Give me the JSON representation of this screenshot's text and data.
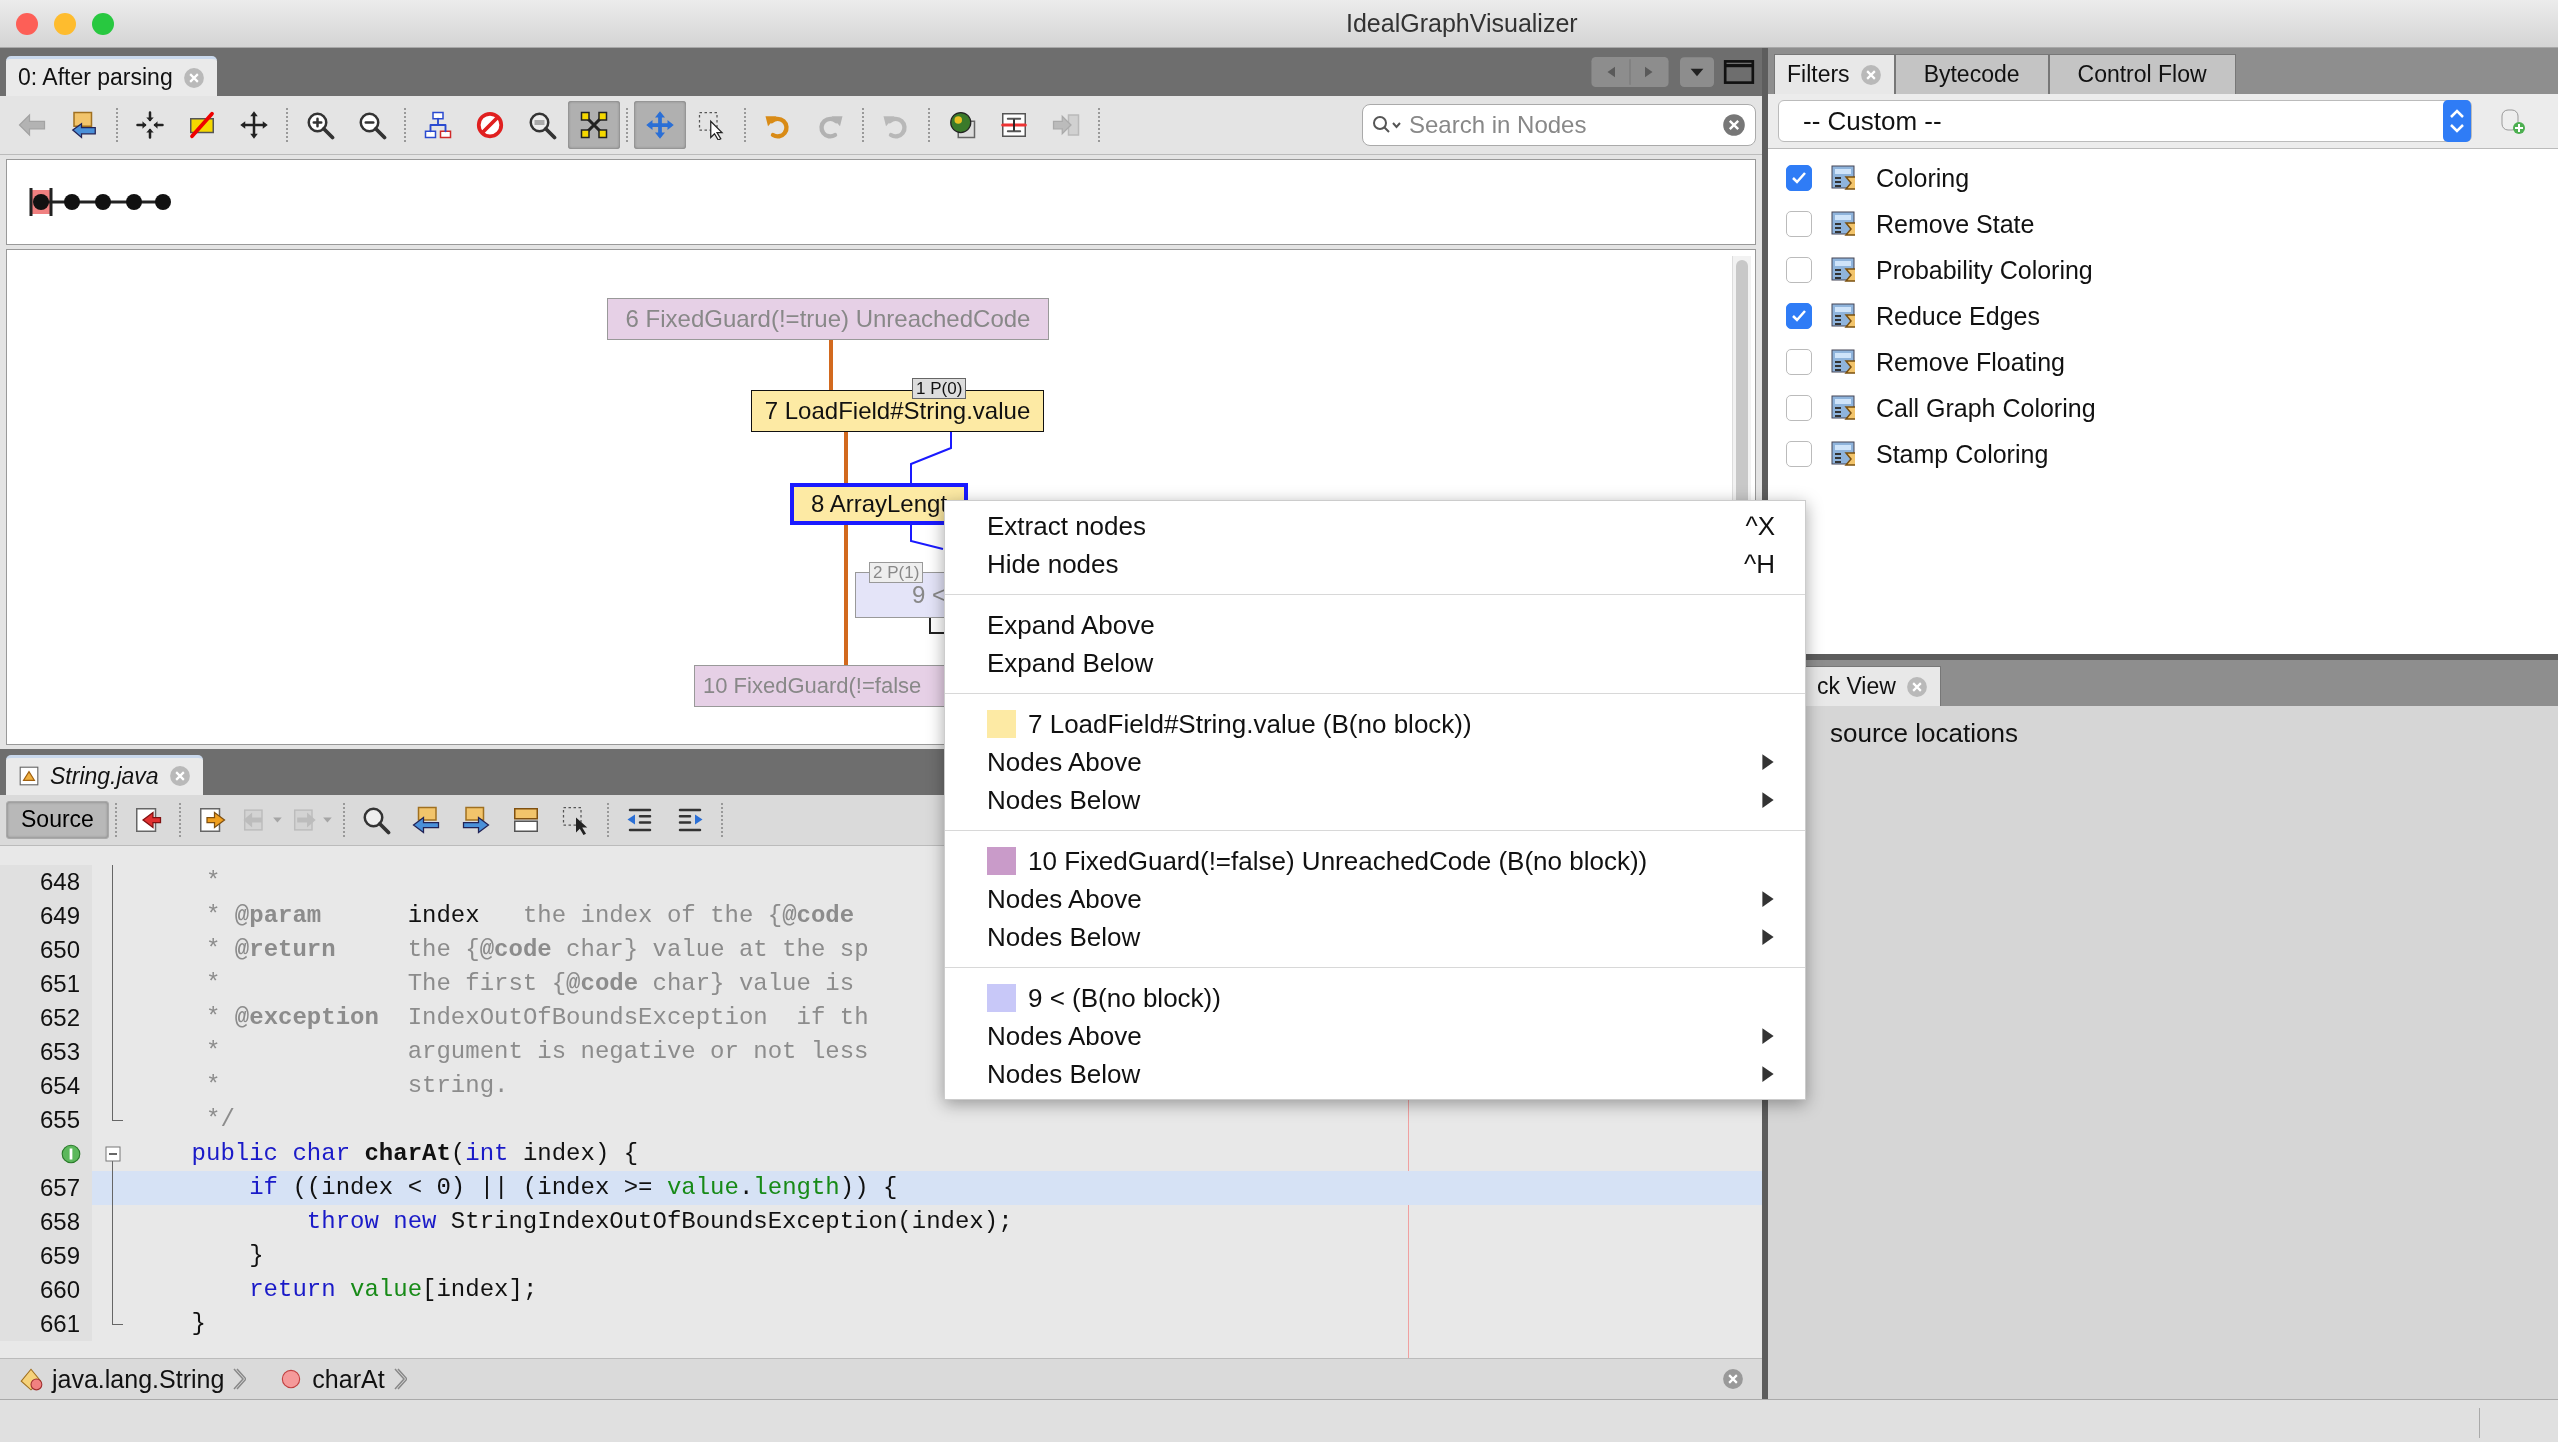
{
  "window": {
    "title": "IdealGraphVisualizer"
  },
  "graph_tab": {
    "label": "0: After parsing",
    "selected": true
  },
  "graph_toolbar": {
    "groups": [
      [
        {
          "selected": false,
          "disabled": true
        },
        {
          "selected": false,
          "disabled": false
        }
      ],
      [
        {
          "selected": false,
          "disabled": false
        },
        {
          "selected": false,
          "disabled": false
        },
        {
          "selected": false,
          "disabled": false
        }
      ],
      [
        {
          "selected": false,
          "disabled": false
        },
        {
          "selected": false,
          "disabled": false
        }
      ],
      [
        {
          "selected": false,
          "disabled": false
        },
        {
          "selected": false,
          "disabled": false
        },
        {
          "selected": false,
          "disabled": false
        },
        {
          "selected": true,
          "disabled": false
        }
      ],
      [
        {
          "selected": true,
          "disabled": false
        },
        {
          "selected": false,
          "disabled": false
        }
      ],
      [
        {
          "selected": false,
          "disabled": false
        },
        {
          "selected": false,
          "disabled": true
        }
      ],
      [
        {
          "selected": false,
          "disabled": true
        }
      ],
      [
        {
          "selected": false,
          "disabled": false
        },
        {
          "selected": false,
          "disabled": false
        },
        {
          "selected": false,
          "disabled": true
        }
      ]
    ],
    "search": {
      "placeholder": "Search in Nodes"
    }
  },
  "graph": {
    "nodes": [
      {
        "label": "6 FixedGuard(!=true) UnreachedCode",
        "color": "#e6d0e6",
        "dimmed": true,
        "selected": false
      },
      {
        "label": "7 LoadField#String.value",
        "color": "#fdeaa4",
        "dimmed": false,
        "selected": false,
        "port": "1 P(0)"
      },
      {
        "label": "8 ArrayLengt",
        "color": "#fdeaa4",
        "dimmed": false,
        "selected": true
      },
      {
        "label": "9 <",
        "color": "#e4e4f8",
        "dimmed": true,
        "selected": false,
        "port": "2 P(1)"
      },
      {
        "label": "10 FixedGuard(!=false",
        "color": "#e6d0e6",
        "dimmed": true,
        "selected": false
      }
    ]
  },
  "source_tab": {
    "label": "String.java"
  },
  "source_toolbar": {
    "source_button": {
      "label": "Source",
      "selected": true
    },
    "groups": [
      [
        {
          "disabled": false
        }
      ],
      [
        {
          "disabled": false
        },
        {
          "disabled": true
        },
        {
          "disabled": true
        }
      ],
      [
        {
          "disabled": false
        },
        {
          "disabled": false
        },
        {
          "disabled": false
        },
        {
          "disabled": false
        },
        {
          "disabled": false
        }
      ],
      [
        {
          "disabled": false
        },
        {
          "disabled": false
        }
      ]
    ]
  },
  "code": {
    "lines": [
      {
        "kind": "number",
        "number": "648",
        "highlighted": false,
        "collapsible": false,
        "block_end": false,
        "tokens": [
          {
            "kind": "comment",
            "text": "     *"
          }
        ]
      },
      {
        "kind": "number",
        "number": "649",
        "highlighted": false,
        "collapsible": false,
        "block_end": false,
        "tokens": [
          {
            "kind": "comment",
            "text": "     * "
          },
          {
            "kind": "doctag",
            "text": "@param"
          },
          {
            "kind": "plain",
            "text": "      index"
          },
          {
            "kind": "comment",
            "text": "   the index of the {"
          },
          {
            "kind": "doctag",
            "text": "@code"
          }
        ]
      },
      {
        "kind": "number",
        "number": "650",
        "highlighted": false,
        "collapsible": false,
        "block_end": false,
        "tokens": [
          {
            "kind": "comment",
            "text": "     * "
          },
          {
            "kind": "doctag",
            "text": "@return"
          },
          {
            "kind": "comment",
            "text": "     the {"
          },
          {
            "kind": "doctag",
            "text": "@code"
          },
          {
            "kind": "comment",
            "text": " char} value at the sp"
          }
        ]
      },
      {
        "kind": "number",
        "number": "651",
        "highlighted": false,
        "collapsible": false,
        "block_end": false,
        "tokens": [
          {
            "kind": "comment",
            "text": "     *             The first {"
          },
          {
            "kind": "doctag",
            "text": "@code"
          },
          {
            "kind": "comment",
            "text": " char} value is"
          }
        ]
      },
      {
        "kind": "number",
        "number": "652",
        "highlighted": false,
        "collapsible": false,
        "block_end": false,
        "tokens": [
          {
            "kind": "comment",
            "text": "     * "
          },
          {
            "kind": "doctag",
            "text": "@exception"
          },
          {
            "kind": "comment",
            "text": "  IndexOutOfBoundsException  if th"
          }
        ]
      },
      {
        "kind": "number",
        "number": "653",
        "highlighted": false,
        "collapsible": false,
        "block_end": false,
        "tokens": [
          {
            "kind": "comment",
            "text": "     *             argument is negative or not less"
          }
        ]
      },
      {
        "kind": "number",
        "number": "654",
        "highlighted": false,
        "collapsible": false,
        "block_end": false,
        "tokens": [
          {
            "kind": "comment",
            "text": "     *             string."
          }
        ]
      },
      {
        "kind": "number",
        "number": "655",
        "highlighted": false,
        "collapsible": false,
        "block_end": true,
        "tokens": [
          {
            "kind": "comment",
            "text": "     */"
          }
        ]
      },
      {
        "kind": "marker",
        "highlighted": false,
        "collapsible": true,
        "block_end": false,
        "tokens": [
          {
            "kind": "keyword",
            "text": "    public char "
          },
          {
            "kind": "method",
            "text": "charAt"
          },
          {
            "kind": "plain",
            "text": "("
          },
          {
            "kind": "keyword",
            "text": "int"
          },
          {
            "kind": "plain",
            "text": " index) {"
          }
        ]
      },
      {
        "kind": "number",
        "number": "657",
        "highlighted": true,
        "collapsible": false,
        "block_end": false,
        "tokens": [
          {
            "kind": "keyword",
            "text": "        if"
          },
          {
            "kind": "plain",
            "text": " ((index < 0) || (index >= "
          },
          {
            "kind": "field",
            "text": "value"
          },
          {
            "kind": "plain",
            "text": "."
          },
          {
            "kind": "field",
            "text": "length"
          },
          {
            "kind": "plain",
            "text": ")) {"
          }
        ]
      },
      {
        "kind": "number",
        "number": "658",
        "highlighted": false,
        "collapsible": false,
        "block_end": false,
        "tokens": [
          {
            "kind": "keyword",
            "text": "            throw new"
          },
          {
            "kind": "plain",
            "text": " StringIndexOutOfBoundsException(index);"
          }
        ]
      },
      {
        "kind": "number",
        "number": "659",
        "highlighted": false,
        "collapsible": false,
        "block_end": false,
        "tokens": [
          {
            "kind": "plain",
            "text": "        }"
          }
        ]
      },
      {
        "kind": "number",
        "number": "660",
        "highlighted": false,
        "collapsible": false,
        "block_end": false,
        "tokens": [
          {
            "kind": "keyword",
            "text": "        return "
          },
          {
            "kind": "field",
            "text": "value"
          },
          {
            "kind": "plain",
            "text": "[index];"
          }
        ]
      },
      {
        "kind": "number",
        "number": "661",
        "highlighted": false,
        "collapsible": false,
        "block_end": true,
        "tokens": [
          {
            "kind": "plain",
            "text": "    }"
          }
        ]
      }
    ]
  },
  "breadcrumbs": [
    {
      "label": "java.lang.String",
      "kind": "class"
    },
    {
      "label": "charAt",
      "kind": "method"
    }
  ],
  "filters": {
    "tabs": [
      {
        "label": "Filters",
        "selected": true,
        "closable": true
      },
      {
        "label": "Bytecode",
        "selected": false,
        "closable": false
      },
      {
        "label": "Control Flow",
        "selected": false,
        "closable": false
      }
    ],
    "profile": "-- Custom --",
    "items": [
      {
        "label": "Coloring",
        "checked": true
      },
      {
        "label": "Remove State",
        "checked": false
      },
      {
        "label": "Probability Coloring",
        "checked": false
      },
      {
        "label": "Reduce Edges",
        "checked": true
      },
      {
        "label": "Remove Floating",
        "checked": false
      },
      {
        "label": "Call Graph Coloring",
        "checked": false
      },
      {
        "label": "Stamp Coloring",
        "checked": false
      }
    ]
  },
  "stack_view": {
    "tab": "ck View",
    "message": "source locations"
  },
  "context_menu": {
    "items": [
      {
        "kind": "item",
        "label": "Extract nodes",
        "shortcut": "^X"
      },
      {
        "kind": "item",
        "label": "Hide nodes",
        "shortcut": "^H"
      },
      {
        "kind": "separator"
      },
      {
        "kind": "item",
        "label": "Expand Above"
      },
      {
        "kind": "item",
        "label": "Expand Below"
      },
      {
        "kind": "separator"
      },
      {
        "kind": "node",
        "label": "7 LoadField#String.value (B(no block))",
        "color": "#fdeaa4"
      },
      {
        "kind": "submenu",
        "label": "Nodes Above"
      },
      {
        "kind": "submenu",
        "label": "Nodes Below"
      },
      {
        "kind": "separator"
      },
      {
        "kind": "node",
        "label": "10 FixedGuard(!=false) UnreachedCode (B(no block))",
        "color": "#c99bc9"
      },
      {
        "kind": "submenu",
        "label": "Nodes Above"
      },
      {
        "kind": "submenu",
        "label": "Nodes Below"
      },
      {
        "kind": "separator"
      },
      {
        "kind": "node",
        "label": "9 < (B(no block))",
        "color": "#c8c8f8"
      },
      {
        "kind": "submenu",
        "label": "Nodes Above"
      },
      {
        "kind": "submenu",
        "label": "Nodes Below"
      }
    ]
  }
}
